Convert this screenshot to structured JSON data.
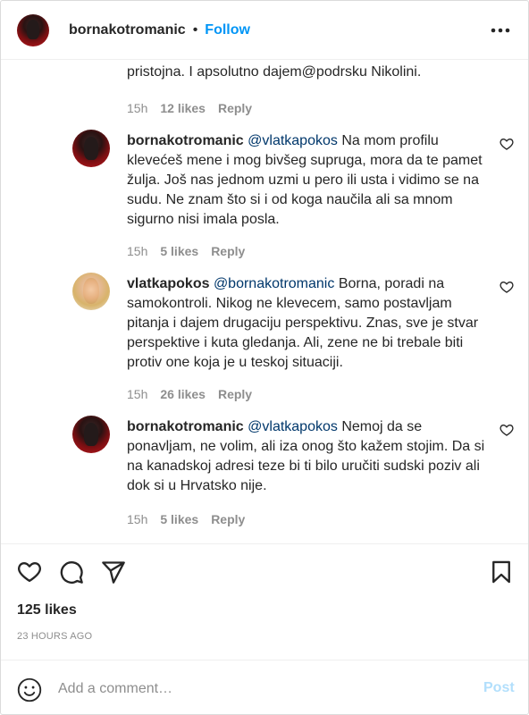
{
  "header": {
    "username": "bornakotromanic",
    "separator": "•",
    "follow_label": "Follow",
    "more_icon": "more-horizontal-icon"
  },
  "partial_comment": {
    "text": "pristojna. I apsolutno dajem@podrsku Nikolini.",
    "time": "15h",
    "likes": "12 likes",
    "reply": "Reply"
  },
  "comments": [
    {
      "author": "bornakotromanic",
      "mention": "@vlatkapokos",
      "text": "Na mom profilu klevećeš mene i mog bivšeg supruga, mora da te pamet žulja. Još nas jednom uzmi u pero ili usta i vidimo se na sudu. Ne znam što si i od koga naučila ali sa mnom sigurno nisi imala posla.",
      "time": "15h",
      "likes": "5 likes",
      "reply": "Reply"
    },
    {
      "author": "vlatkapokos",
      "mention": "@bornakotromanic",
      "text": "Borna, poradi na samokontroli. Nikog ne klevecem, samo postavljam pitanja i dajem drugaciju perspektivu. Znas, sve je stvar perspektive i kuta gledanja. Ali, zene ne bi trebale biti protiv one koja je u teskoj situaciji.",
      "time": "15h",
      "likes": "26 likes",
      "reply": "Reply"
    },
    {
      "author": "bornakotromanic",
      "mention": "@vlatkapokos",
      "text": "Nemoj da se ponavljam, ne volim, ali iza onog što kažem stojim. Da si na kanadskoj adresi teze bi ti bilo uručiti sudski poziv ali dok si u Hrvatsko nije.",
      "time": "15h",
      "likes": "5 likes",
      "reply": "Reply"
    }
  ],
  "actions": {
    "icons": [
      "heart-icon",
      "comment-bubble-icon",
      "share-plane-icon",
      "bookmark-icon"
    ]
  },
  "post_stats": {
    "likes": "125 likes",
    "time_ago": "23 HOURS AGO"
  },
  "add_comment": {
    "emoji_icon": "emoji-smile-icon",
    "placeholder": "Add a comment…",
    "post_label": "Post"
  },
  "colors": {
    "accent": "#0095f6",
    "mention": "#00376b",
    "muted": "#8e8e8e",
    "text": "#262626",
    "post_disabled": "#b2dffc"
  }
}
